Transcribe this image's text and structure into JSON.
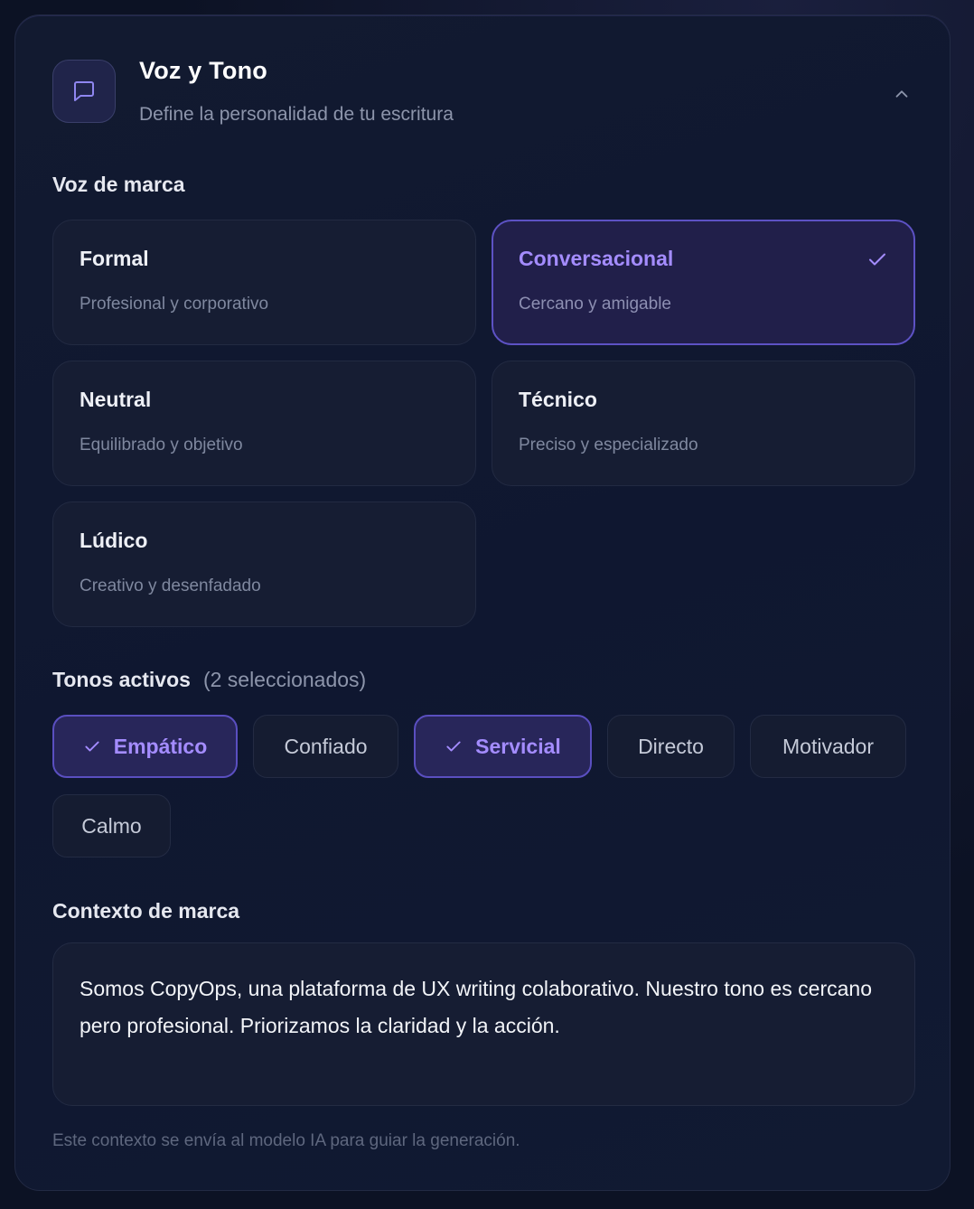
{
  "header": {
    "icon": "chat-bubble-icon",
    "title": "Voz y Tono",
    "subtitle": "Define la personalidad de tu escritura",
    "collapse_icon": "chevron-up-icon"
  },
  "voice": {
    "label": "Voz de marca",
    "options": [
      {
        "title": "Formal",
        "description": "Profesional y corporativo",
        "selected": false
      },
      {
        "title": "Conversacional",
        "description": "Cercano y amigable",
        "selected": true
      },
      {
        "title": "Neutral",
        "description": "Equilibrado y objetivo",
        "selected": false
      },
      {
        "title": "Técnico",
        "description": "Preciso y especializado",
        "selected": false
      },
      {
        "title": "Lúdico",
        "description": "Creativo y desenfadado",
        "selected": false
      }
    ]
  },
  "tones": {
    "label": "Tonos activos",
    "count_label": "(2 seleccionados)",
    "chips": [
      {
        "label": "Empático",
        "active": true
      },
      {
        "label": "Confiado",
        "active": false
      },
      {
        "label": "Servicial",
        "active": true
      },
      {
        "label": "Directo",
        "active": false
      },
      {
        "label": "Motivador",
        "active": false
      },
      {
        "label": "Calmo",
        "active": false
      }
    ]
  },
  "context": {
    "label": "Contexto de marca",
    "value": "Somos CopyOps, una plataforma de UX writing colaborativo. Nuestro tono es cercano pero profesional. Priorizamos la claridad y la acción.",
    "hint": "Este contexto se envía al modelo IA para guiar la generación."
  },
  "colors": {
    "accent": "#a48cff",
    "selected_border": "#5d52c4",
    "background": "#0c1224"
  }
}
